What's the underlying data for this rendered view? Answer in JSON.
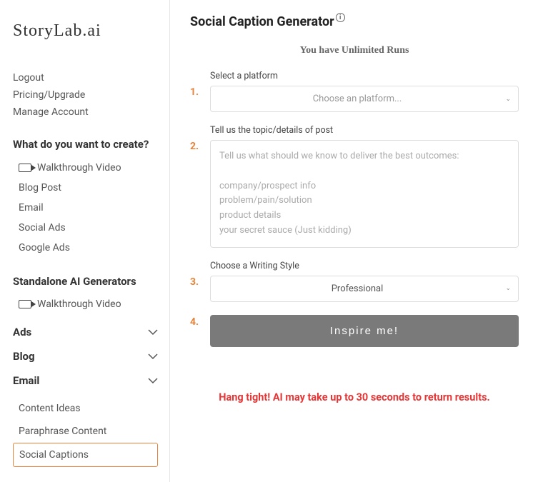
{
  "logo": "StoryLab.ai",
  "accountLinks": {
    "logout": "Logout",
    "pricing": "Pricing/Upgrade",
    "manage": "Manage Account"
  },
  "createSection": {
    "heading": "What do you want to create?",
    "items": [
      {
        "label": "Walkthrough Video",
        "hasVideoIcon": true
      },
      {
        "label": "Blog Post"
      },
      {
        "label": "Email"
      },
      {
        "label": "Social Ads"
      },
      {
        "label": "Google Ads"
      }
    ]
  },
  "standaloneSection": {
    "heading": "Standalone AI Generators",
    "walkthrough": "Walkthrough Video"
  },
  "collapsibles": {
    "ads": "Ads",
    "blog": "Blog",
    "email": "Email"
  },
  "subLinks": {
    "contentIdeas": "Content Ideas",
    "paraphrase": "Paraphrase Content",
    "socialCaptions": "Social Captions"
  },
  "main": {
    "title": "Social Caption Generator",
    "runsBanner": "You have Unlimited Runs",
    "steps": {
      "s1num": "1.",
      "s1label": "Select a platform",
      "s1placeholder": "Choose an platform...",
      "s2num": "2.",
      "s2label": "Tell us the topic/details of post",
      "s2placeholder": "Tell us what should we know to deliver the best outcomes:\n\ncompany/prospect info\nproblem/pain/solution\nproduct details\nyour secret sauce (Just kidding)",
      "s3num": "3.",
      "s3label": "Choose a Writing Style",
      "s3value": "Professional",
      "s4num": "4.",
      "button": "Inspire me!"
    },
    "waitMessage": "Hang tight! AI may take up to 30 seconds to return results."
  }
}
